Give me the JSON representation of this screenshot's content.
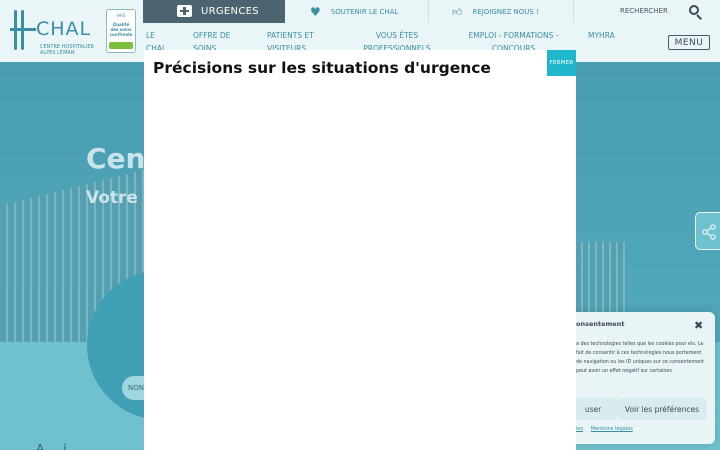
{
  "colors": {
    "accent": "#3a8fa3",
    "urgences_bg": "#4b6470",
    "modal_close_bg": "#1fb7cc",
    "hero_overlay": "#6fc1cf"
  },
  "header": {
    "logo": {
      "name": "CHAL",
      "subtitle": "CENTRE HOSPITALIER ALPES LÉMAN",
      "icon": "chal-logo-icon"
    },
    "badge": {
      "top": "HAS",
      "line1": "Qualité",
      "line2": "des soins",
      "line3": "confirmée",
      "icon": "has-quality-badge"
    },
    "urgences": {
      "label": "URGENCES",
      "icon": "first-aid-icon"
    },
    "top_links": [
      {
        "label": "SOUTENIR LE CHAL",
        "icon": "heart-icon"
      },
      {
        "label": "REJOIGNEZ NOUS !",
        "icon": "thumbs-up-icon"
      }
    ],
    "search": {
      "label": "RECHERCHER",
      "icon": "search-icon"
    },
    "main_nav": [
      {
        "line1": "LE",
        "line2": "CHAL"
      },
      {
        "line1": "OFFRE DE",
        "line2": "SOINS"
      },
      {
        "line1": "PATIENTS ET",
        "line2": "VISITEURS"
      },
      {
        "line1": "VOUS ÊTES",
        "line2": "PROFESSIONNELS"
      },
      {
        "line1": "EMPLOI - FORMATIONS -",
        "line2": "CONCOURS"
      },
      {
        "line1": "MYHRA",
        "line2": ""
      }
    ],
    "menu_label": "MENU"
  },
  "hero": {
    "title": "Cen",
    "subtitle": "Votre",
    "pill": "NON",
    "bottom_text": "A ... i"
  },
  "share": {
    "icon": "share-icon"
  },
  "cookie": {
    "title": "onsentement",
    "close_icon": "close-icon",
    "text": "a des technologies telles que les cookies pour els. Le fait de consentir à ces technologies nous portement de navigation ou les ID uniques sur ce consentement peut avoir un effet négatif sur certaines",
    "button1": "user",
    "button2": "Voir les préférences",
    "links": [
      "ies",
      "Mentions légales"
    ]
  },
  "modal": {
    "title": "Précisions sur les situations d'urgence",
    "close_label": "FERMER"
  }
}
